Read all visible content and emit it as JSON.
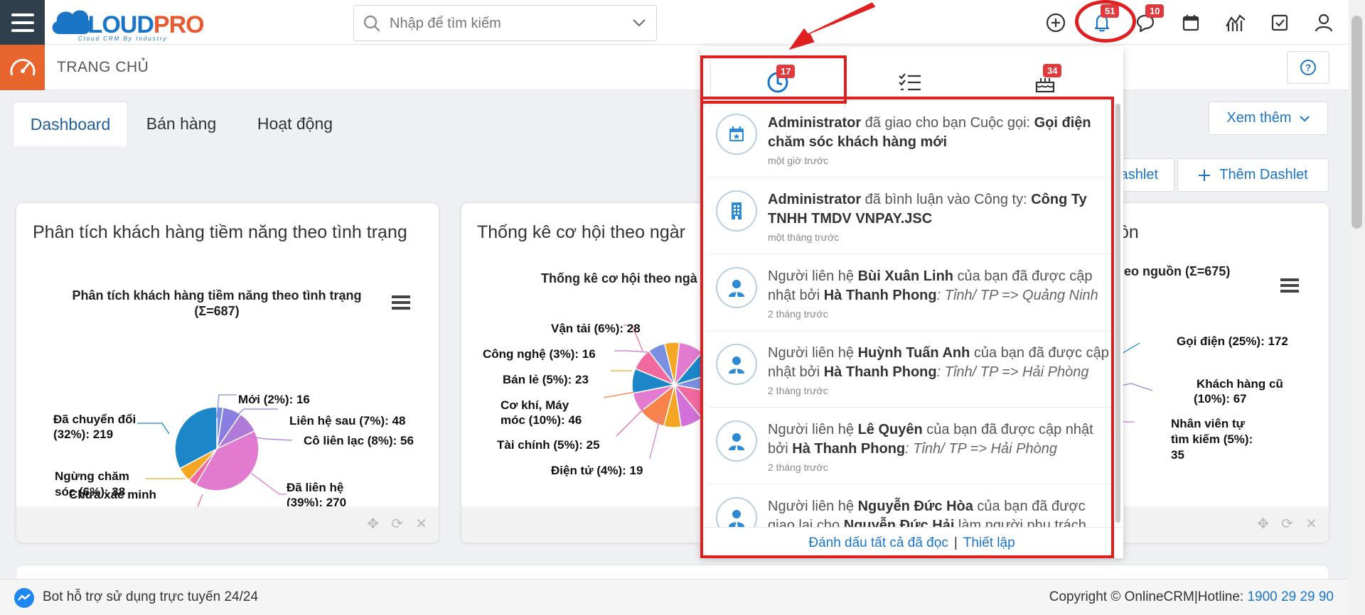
{
  "header": {
    "logo_text_a": "CLOUD",
    "logo_text_b": "PRO",
    "logo_tagline": "Cloud CRM By Industry",
    "search_placeholder": "Nhập để tìm kiếm",
    "badges": {
      "notifications": "51",
      "messages": "10"
    },
    "icons": [
      "add-icon",
      "bell-icon",
      "chat-icon",
      "calendar-icon",
      "report-icon",
      "task-icon",
      "user-icon"
    ]
  },
  "subheader": {
    "title": "TRANG CHỦ"
  },
  "tabs": [
    {
      "label": "Dashboard",
      "active": true
    },
    {
      "label": "Bán hàng",
      "active": false
    },
    {
      "label": "Hoạt động",
      "active": false
    }
  ],
  "actions": {
    "more_label": "Xem thêm",
    "dashlet_partial": "ashlet",
    "add_dashlet": "Thêm Dashlet"
  },
  "panels": [
    {
      "title": "Phân tích khách hàng tiềm năng theo tình trạng",
      "chart_title_line1": "Phân tích khách hàng tiềm năng theo tình trạng",
      "chart_title_line2": "(Σ=687)"
    },
    {
      "title": "Thống kê cơ hội theo ngàr",
      "chart_title": "Thống kê cơ hội theo ngà"
    },
    {
      "title": "ıồn",
      "chart_title": "eo nguồn (Σ=675)"
    }
  ],
  "chart_data": [
    {
      "type": "pie",
      "title": "Phân tích khách hàng tiềm năng theo tình trạng (Σ=687)",
      "total": 687,
      "slices": [
        {
          "label": "Mới (2%): 16",
          "name": "Mới",
          "value": 16,
          "color": "#7b8fe0"
        },
        {
          "label": "Liên hệ sau (7%): 48",
          "name": "Liên hệ sau",
          "value": 48,
          "color": "#8a7fe0"
        },
        {
          "label": "Cô liên lạc (8%): 56",
          "name": "Cô liên lạc",
          "value": 56,
          "color": "#b07ad8"
        },
        {
          "label": "Đã liên hệ (39%): 270",
          "name": "Đã liên hệ",
          "value": 270,
          "color": "#e27ad0"
        },
        {
          "label": "Chưa xác minh",
          "name": "Chưa xác minh",
          "value": 21,
          "color": "#f06aa0"
        },
        {
          "label": "Ngừng chăm sóc (6%): 38",
          "name": "Ngừng chăm sóc",
          "value": 38,
          "color": "#f5a623"
        },
        {
          "label": "Đã chuyển đổi (32%): 219",
          "name": "Đã chuyển đổi",
          "value": 219,
          "color": "#1b87c9"
        }
      ]
    },
    {
      "type": "pie",
      "title": "Thống kê cơ hội theo ngà",
      "slices": [
        {
          "label": "Vận tải (6%): 28",
          "value": 28,
          "color": "#f06aa0"
        },
        {
          "label": "Công nghệ (3%): 16",
          "value": 16,
          "color": "#d070d8"
        },
        {
          "label": "Bán lẻ (5%): 23",
          "value": 23,
          "color": "#f5a623"
        },
        {
          "label": "Cơ khí, Máy móc (10%): 46",
          "value": 46,
          "color": "#f7824a"
        },
        {
          "label": "Tài chính (5%): 25",
          "value": 25,
          "color": "#f06aa0"
        },
        {
          "label": "Điện tử (4%): 19",
          "value": 19,
          "color": "#e27ad0"
        }
      ]
    },
    {
      "type": "pie",
      "title": "eo nguồn (Σ=675)",
      "total": 675,
      "slices": [
        {
          "label": "Gọi điện (25%): 172",
          "value": 172,
          "color": "#1b87c9"
        },
        {
          "label": "Khách hàng cũ (10%): 67",
          "value": 67,
          "color": "#7b8fe0"
        },
        {
          "label": "Nhân viên tự tìm kiếm (5%): 35",
          "value": 35,
          "color": "#e27ad0"
        }
      ]
    }
  ],
  "notifications": {
    "tabs": [
      {
        "icon": "recent-icon",
        "badge": "17"
      },
      {
        "icon": "checklist-icon",
        "badge": ""
      },
      {
        "icon": "birthday-cake-icon",
        "badge": "34"
      }
    ],
    "items": [
      {
        "icon": "calendar-icon",
        "actor": "Administrator",
        "mid": " đã giao cho bạn Cuộc gọi: ",
        "object": "Gọi điện chăm sóc khách hàng mới",
        "time": "một giờ trước"
      },
      {
        "icon": "building-icon",
        "actor": "Administrator",
        "mid": " đã bình luận vào Công ty: ",
        "object": "Công Ty TNHH TMDV VNPAY.JSC",
        "time": "một tháng trước"
      },
      {
        "icon": "contact-icon",
        "pre": "Người liên hệ ",
        "actor": "Bùi Xuân Linh",
        "mid": " của bạn đã được cập nhật bởi ",
        "object": "Hà Thanh Phong",
        "detail": ": Tỉnh/ TP => Quảng Ninh",
        "time": "2 tháng trước"
      },
      {
        "icon": "contact-icon",
        "pre": "Người liên hệ ",
        "actor": "Huỳnh Tuấn Anh",
        "mid": " của bạn đã được cập nhật bởi ",
        "object": "Hà Thanh Phong",
        "detail": ": Tỉnh/ TP => Hải Phòng",
        "time": "2 tháng trước"
      },
      {
        "icon": "contact-icon",
        "pre": "Người liên hệ ",
        "actor": "Lê Quyên",
        "mid": " của bạn đã được cập nhật bởi ",
        "object": "Hà Thanh Phong",
        "detail": ": Tỉnh/ TP => Hải Phòng",
        "time": "2 tháng trước"
      },
      {
        "icon": "contact-icon",
        "pre": "Người liên hệ ",
        "actor": "Nguyễn Đức Hòa",
        "mid": " của bạn đã được giao lại cho ",
        "object": "Nguyễn Đức Hải",
        "detail": " làm người phụ trách bởi",
        "time": ""
      }
    ],
    "footer_mark_read": "Đánh dấu tất cả đã đọc",
    "footer_separator": "|",
    "footer_settings": "Thiết lập"
  },
  "statusbar": {
    "left": "Bot hỗ trợ sử dụng trực tuyến 24/24",
    "copyright": "Copyright © OnlineCRM",
    "hotline_label": "Hotline: ",
    "hotline": "1900 29 29 90",
    "separator": "|"
  },
  "colors": {
    "accent": "#1a75c7",
    "brand_orange": "#e8652e",
    "badge_red": "#e03a3e",
    "annotation_red": "#e02020",
    "sidebar_dark": "#2f3f4b"
  }
}
